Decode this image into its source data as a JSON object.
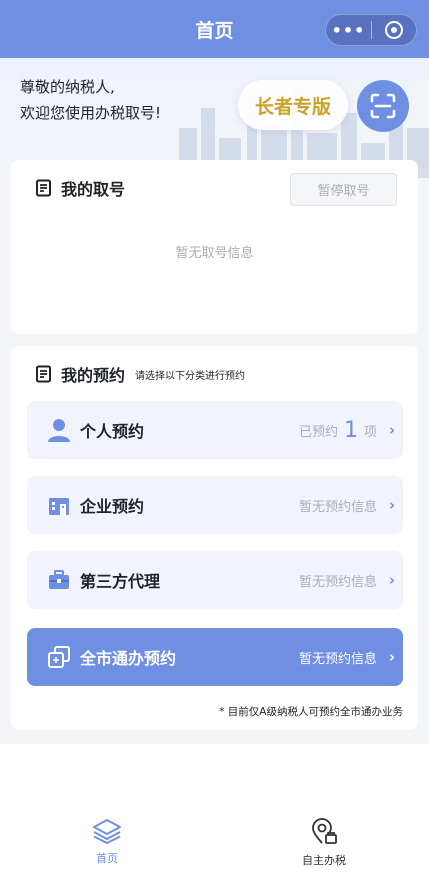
{
  "navbar": {
    "title": "首页",
    "more_label": "•••"
  },
  "hero": {
    "greeting_line1": "尊敬的纳税人,",
    "greeting_line2": "欢迎您使用办税取号!",
    "elder_button": "长者专版",
    "scan_icon": "scan-icon"
  },
  "queue_card": {
    "title": "我的取号",
    "pause_button": "暂停取号",
    "empty_text": "暂无取号信息"
  },
  "appointment_card": {
    "title": "我的预约",
    "subtitle": "请选择以下分类进行预约",
    "rows": [
      {
        "label": "个人预约",
        "status_prefix": "已预约",
        "count": "1",
        "status_suffix": "项",
        "icon": "person-icon"
      },
      {
        "label": "企业预约",
        "status": "暂无预约信息",
        "icon": "building-icon"
      },
      {
        "label": "第三方代理",
        "status": "暂无预约信息",
        "icon": "briefcase-icon"
      },
      {
        "label": "全市通办预约",
        "status": "暂无预约信息",
        "icon": "copy-icon"
      }
    ],
    "note": "* 目前仅A级纳税人可预约全市通办业务"
  },
  "tabbar": {
    "items": [
      {
        "label": "首页",
        "icon": "layers-icon",
        "active": true
      },
      {
        "label": "自主办税",
        "icon": "location-icon",
        "active": false
      }
    ]
  },
  "colors": {
    "primary": "#6f8fe3",
    "elder_text": "#c9a227",
    "muted": "#a9adb5",
    "background": "#f3f5f9"
  }
}
